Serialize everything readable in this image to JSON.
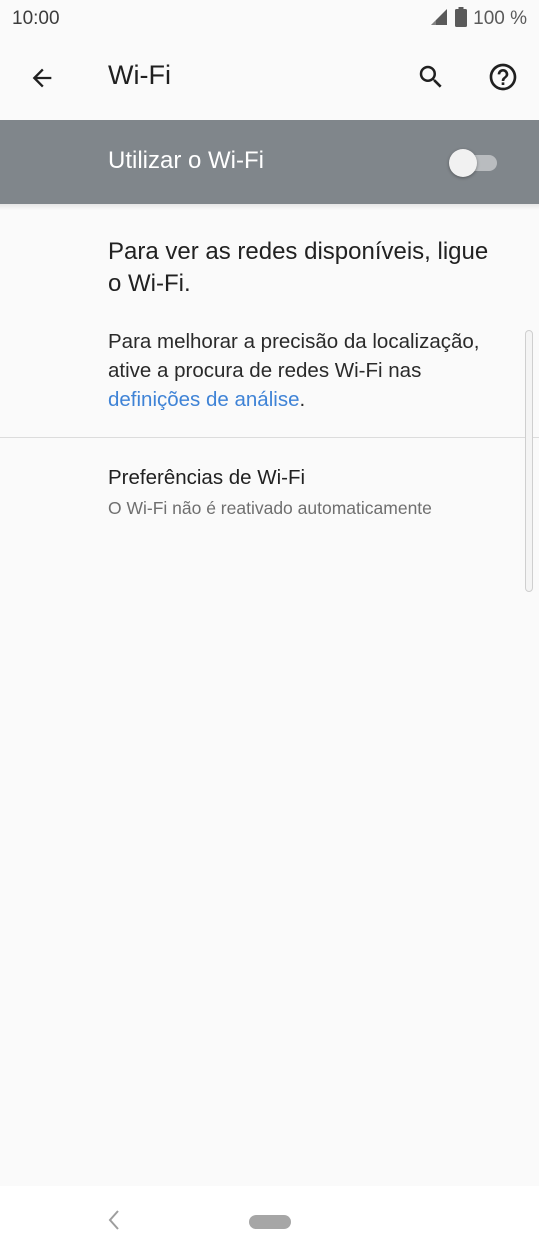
{
  "status_bar": {
    "time": "10:00",
    "battery_text": "100 %",
    "signal_icon": "signal-icon",
    "battery_icon": "battery-icon"
  },
  "app_bar": {
    "title": "Wi-Fi",
    "back_icon": "arrow-back-icon",
    "search_icon": "search-icon",
    "help_icon": "help-icon"
  },
  "master_switch": {
    "label": "Utilizar o Wi-Fi",
    "checked": false,
    "colors": {
      "background": "#80868b",
      "text": "#ffffff"
    }
  },
  "content": {
    "off_heading": "Para ver as redes disponíveis, ligue o Wi-Fi.",
    "scan_note_prefix": "Para melhorar a precisão da localização, ative a procura de redes Wi-Fi nas ",
    "scan_note_link": "definições de análise",
    "scan_note_suffix": ".",
    "link_color": "#3f83d6"
  },
  "preferences": {
    "title": "Preferências de Wi-Fi",
    "summary": "O Wi-Fi não é reativado automaticamente"
  },
  "nav_bar": {
    "back_icon": "nav-back-icon",
    "home_icon": "nav-home-pill-icon"
  }
}
